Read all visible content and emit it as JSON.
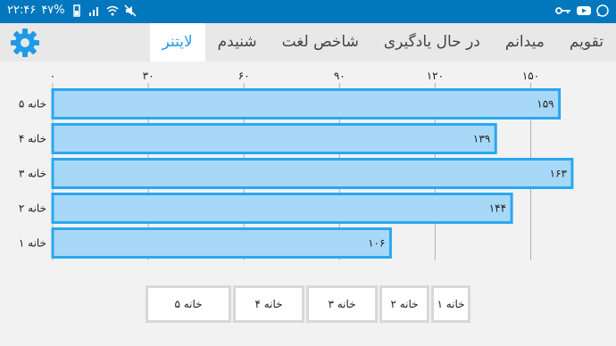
{
  "status_bar": {
    "time": "۲۲:۴۶",
    "battery": "۴۷%",
    "icons": [
      "battery-icon",
      "signal-icon",
      "wifi-icon",
      "mute-icon",
      "key-icon",
      "youtube-icon",
      "whatsapp-icon"
    ]
  },
  "tabs": [
    {
      "label": "تقویم",
      "active": false
    },
    {
      "label": "میدانم",
      "active": false
    },
    {
      "label": "در حال یادگیری",
      "active": false
    },
    {
      "label": "شاخص لغت",
      "active": false
    },
    {
      "label": "شنیدم",
      "active": false
    },
    {
      "label": "لایتنر",
      "active": true
    }
  ],
  "settings_icon": "gear-icon",
  "colors": {
    "accent": "#1e9be8",
    "bar_fill": "#a8d8f8",
    "bar_stroke": "#29a8f0",
    "status": "#0277bd"
  },
  "chart_data": {
    "type": "bar",
    "orientation": "horizontal",
    "categories": [
      "خانه ۵",
      "خانه ۴",
      "خانه ۳",
      "خانه ۲",
      "خانه ۱"
    ],
    "values": [
      159,
      139,
      163,
      144,
      106
    ],
    "value_labels": [
      "۱۵۹",
      "۱۳۹",
      "۱۶۳",
      "۱۴۴",
      "۱۰۶"
    ],
    "ticks": [
      0,
      30,
      60,
      90,
      120,
      150
    ],
    "tick_labels": [
      "۰",
      "۳۰",
      "۶۰",
      "۹۰",
      "۱۲۰",
      "۱۵۰"
    ],
    "xlim": [
      0,
      168
    ],
    "grid": true,
    "legend_position": "bottom"
  },
  "legend": [
    "خانه ۱",
    "خانه ۲",
    "خانه ۳",
    "خانه ۴",
    "خانه ۵"
  ]
}
